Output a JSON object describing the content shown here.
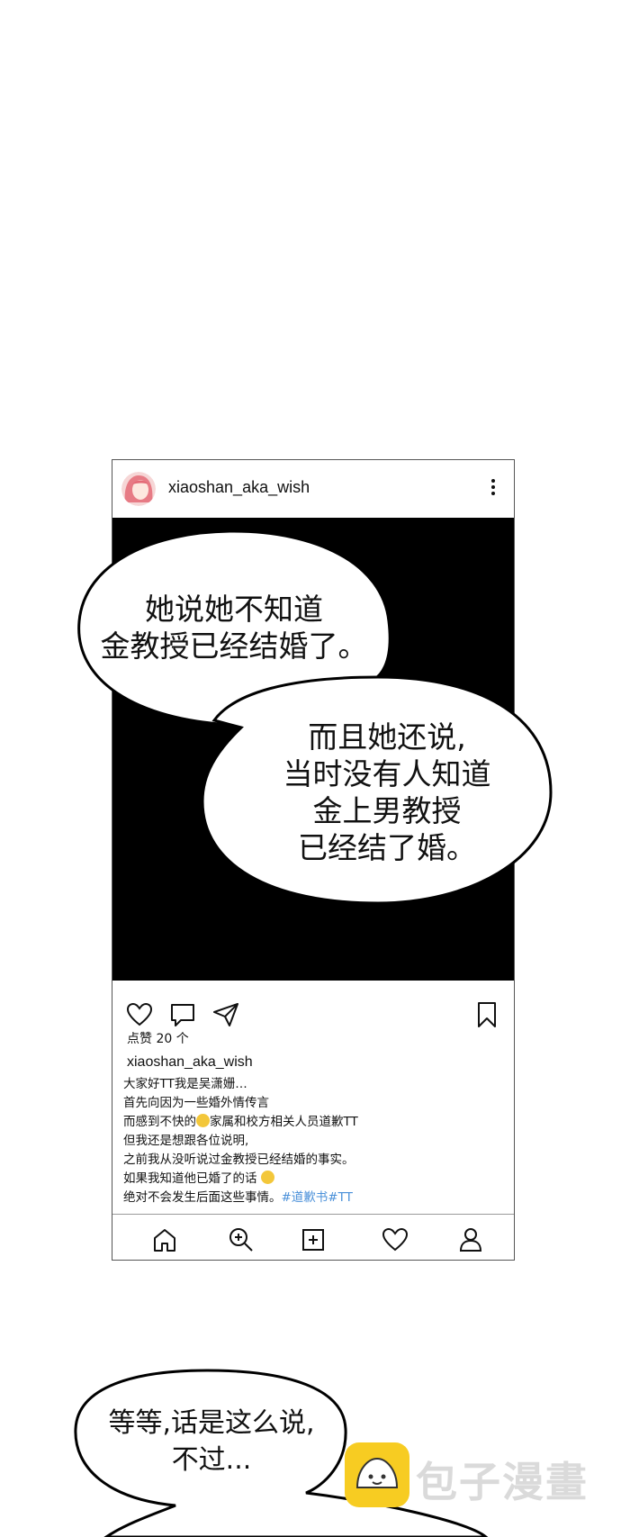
{
  "post": {
    "username": "xiaoshan_aka_wish",
    "likes": "点赞 20 个",
    "caption_username": "xiaoshan_aka_wish",
    "caption_lines": [
      "大家好TT我是吴潇姗…",
      "首先向因为一些婚外情传言",
      "而感到不快的",
      "家属和校方相关人员道歉TT",
      "但我还是想跟各位说明,",
      "之前我从没听说过金教授已经结婚的事实。",
      "如果我知道他已婚了的话",
      "绝对不会发生后面这些事情。"
    ],
    "hashtags": "#道歉书#TT"
  },
  "bubbles": {
    "one": [
      "她说她不知道",
      "金教授已经结婚了。"
    ],
    "two": [
      "而且她还说,",
      "当时没有人知道",
      "金上男教授",
      "已经结了婚。"
    ],
    "three": [
      "等等,话是这么说,",
      "不过..."
    ]
  },
  "watermark": "包子漫畫",
  "colors": {
    "hashtag": "#4a90d9",
    "watermark_logo": "#f7cc22"
  }
}
